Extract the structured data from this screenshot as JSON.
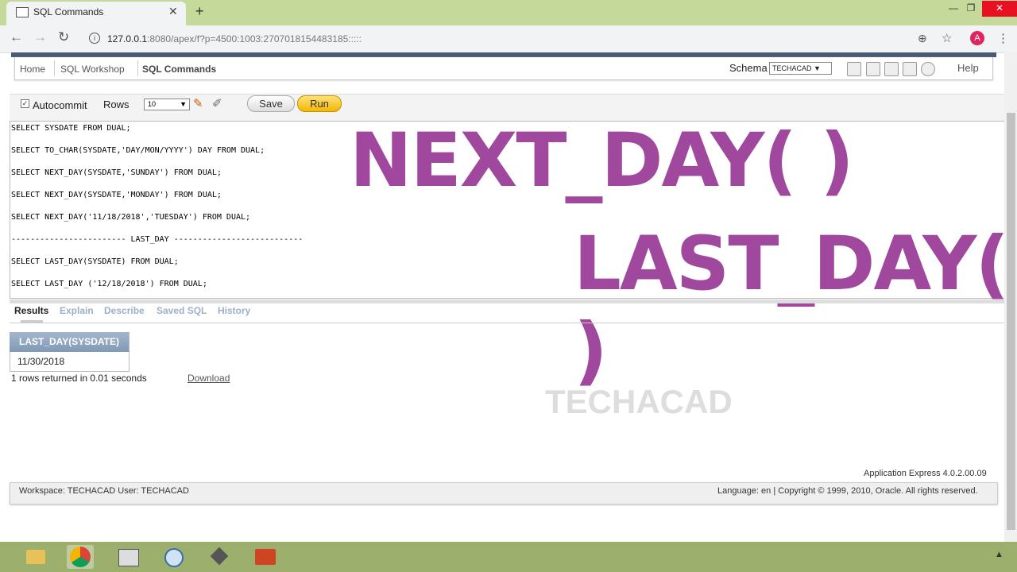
{
  "browser": {
    "tab_title": "SQL Commands",
    "url_host": "127.0.0.1",
    "url_rest": ":8080/apex/f?p=4500:1003:2707018154483185:::::",
    "avatar_letter": "A"
  },
  "breadcrumb": [
    "Home",
    "SQL Workshop",
    "SQL Commands"
  ],
  "schema": {
    "label": "Schema",
    "value": "TECHACAD"
  },
  "help_label": "Help",
  "command_bar": {
    "autocommit_label": "Autocommit",
    "autocommit_checked": true,
    "rows_label": "Rows",
    "rows_value": "10",
    "save_label": "Save",
    "run_label": "Run"
  },
  "editor_lines": [
    "SELECT SYSDATE FROM DUAL;",
    "SELECT TO_CHAR(SYSDATE,'DAY/MON/YYYY') DAY FROM DUAL;",
    "SELECT NEXT_DAY(SYSDATE,'SUNDAY') FROM DUAL;",
    "SELECT NEXT_DAY(SYSDATE,'MONDAY') FROM DUAL;",
    "SELECT NEXT_DAY('11/18/2018','TUESDAY') FROM DUAL;",
    "------------------------ LAST_DAY ---------------------------",
    "SELECT LAST_DAY(SYSDATE) FROM DUAL;",
    "SELECT LAST_DAY ('12/18/2018') FROM DUAL;"
  ],
  "overlay": {
    "line1": "NEXT_DAY( )",
    "line2": "LAST_DAY( )"
  },
  "result_tabs": [
    "Results",
    "Explain",
    "Describe",
    "Saved SQL",
    "History"
  ],
  "results": {
    "column_header": "LAST_DAY(SYSDATE)",
    "cell": "11/30/2018",
    "rows_returned": "1 rows returned in 0.01 seconds",
    "download_label": "Download"
  },
  "watermark": "TECHACAD",
  "apex_version": "Application Express 4.0.2.00.09",
  "footer": {
    "left": "Workspace: TECHACAD User: TECHACAD",
    "right": "Language: en | Copyright © 1999, 2010, Oracle. All rights reserved."
  },
  "colors": {
    "overlay": "#a0479e",
    "run_button": "#f5b700",
    "taskbar": "#9caf6c"
  }
}
